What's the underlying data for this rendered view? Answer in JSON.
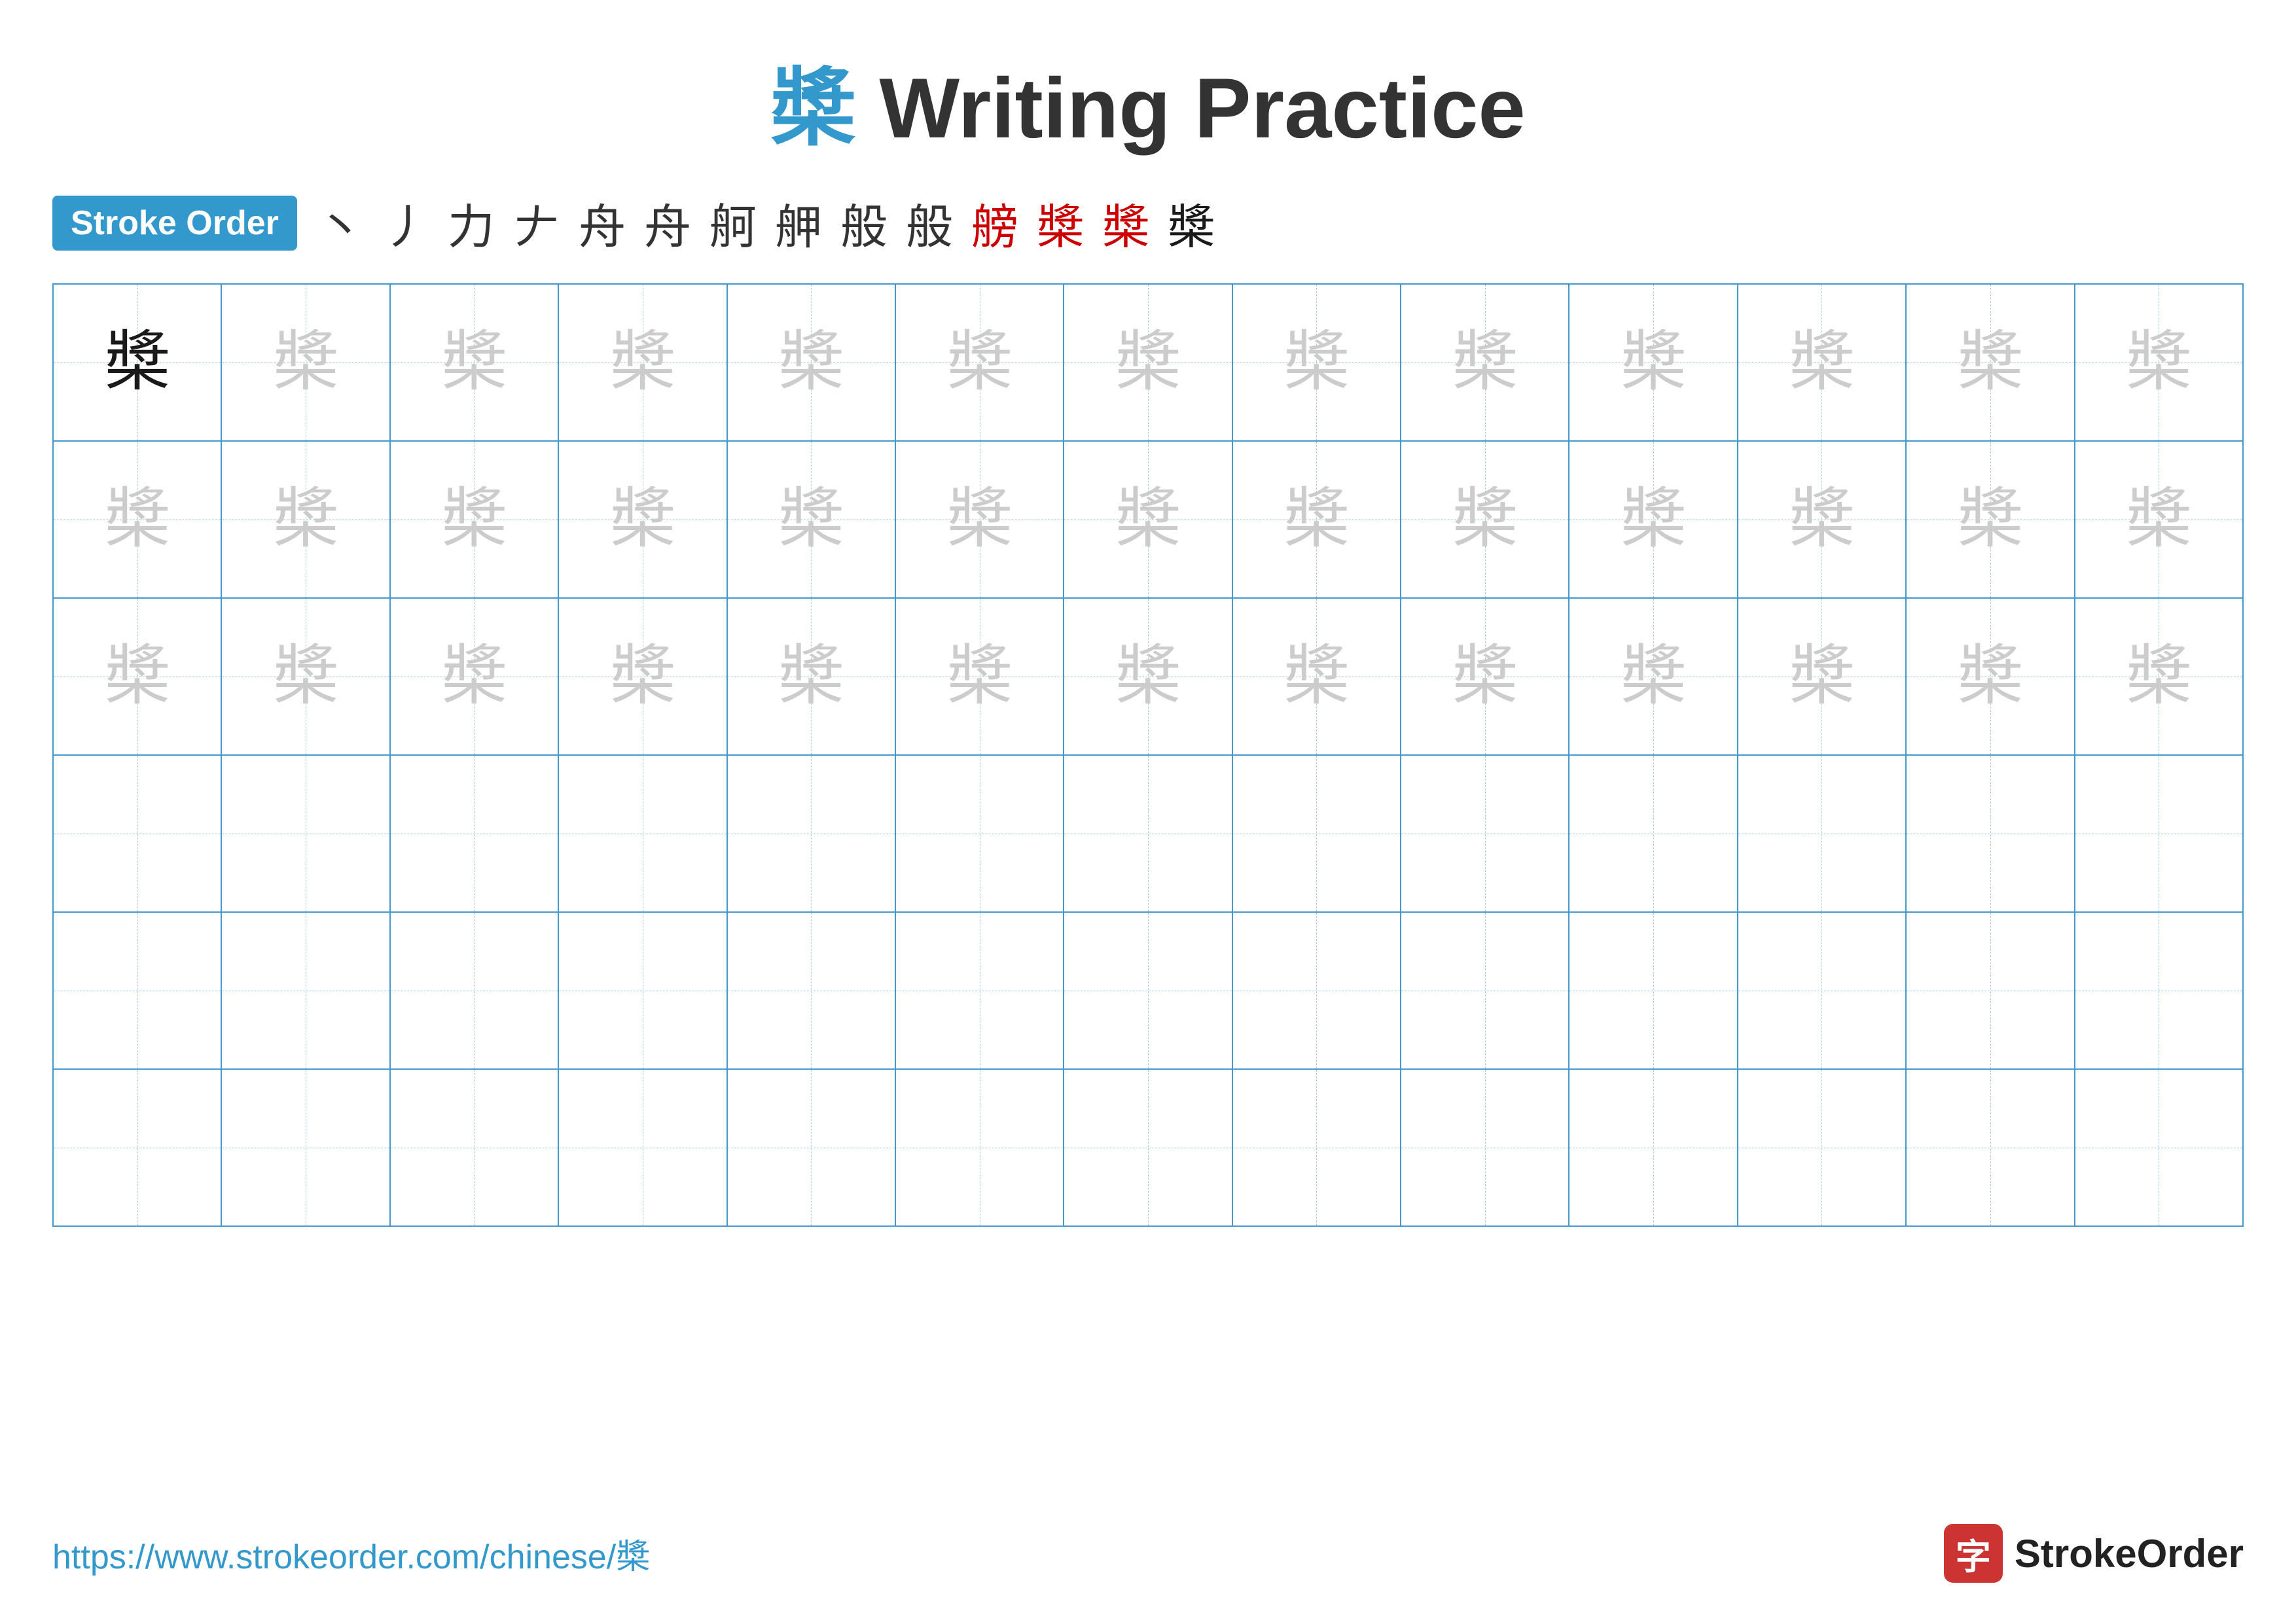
{
  "title": {
    "char": "槳",
    "text": " Writing Practice"
  },
  "stroke_order": {
    "badge_label": "Stroke Order",
    "strokes": [
      {
        "char": "丶",
        "style": "normal"
      },
      {
        "char": "丿",
        "style": "normal"
      },
      {
        "char": "力",
        "style": "normal"
      },
      {
        "char": "𠂇",
        "style": "normal"
      },
      {
        "char": "舟",
        "style": "normal"
      },
      {
        "char": "舟",
        "style": "normal"
      },
      {
        "char": "舸",
        "style": "normal"
      },
      {
        "char": "舺",
        "style": "normal"
      },
      {
        "char": "般",
        "style": "normal"
      },
      {
        "char": "般",
        "style": "normal"
      },
      {
        "char": "艕",
        "style": "red"
      },
      {
        "char": "槳",
        "style": "red"
      },
      {
        "char": "槳",
        "style": "red"
      },
      {
        "char": "槳",
        "style": "dark"
      }
    ]
  },
  "practice": {
    "main_char": "槳",
    "ghost_char": "槳",
    "rows": 6,
    "cols": 13
  },
  "footer": {
    "url": "https://www.strokeorder.com/chinese/槳",
    "logo_icon": "字",
    "logo_text": "StrokeOrder"
  }
}
